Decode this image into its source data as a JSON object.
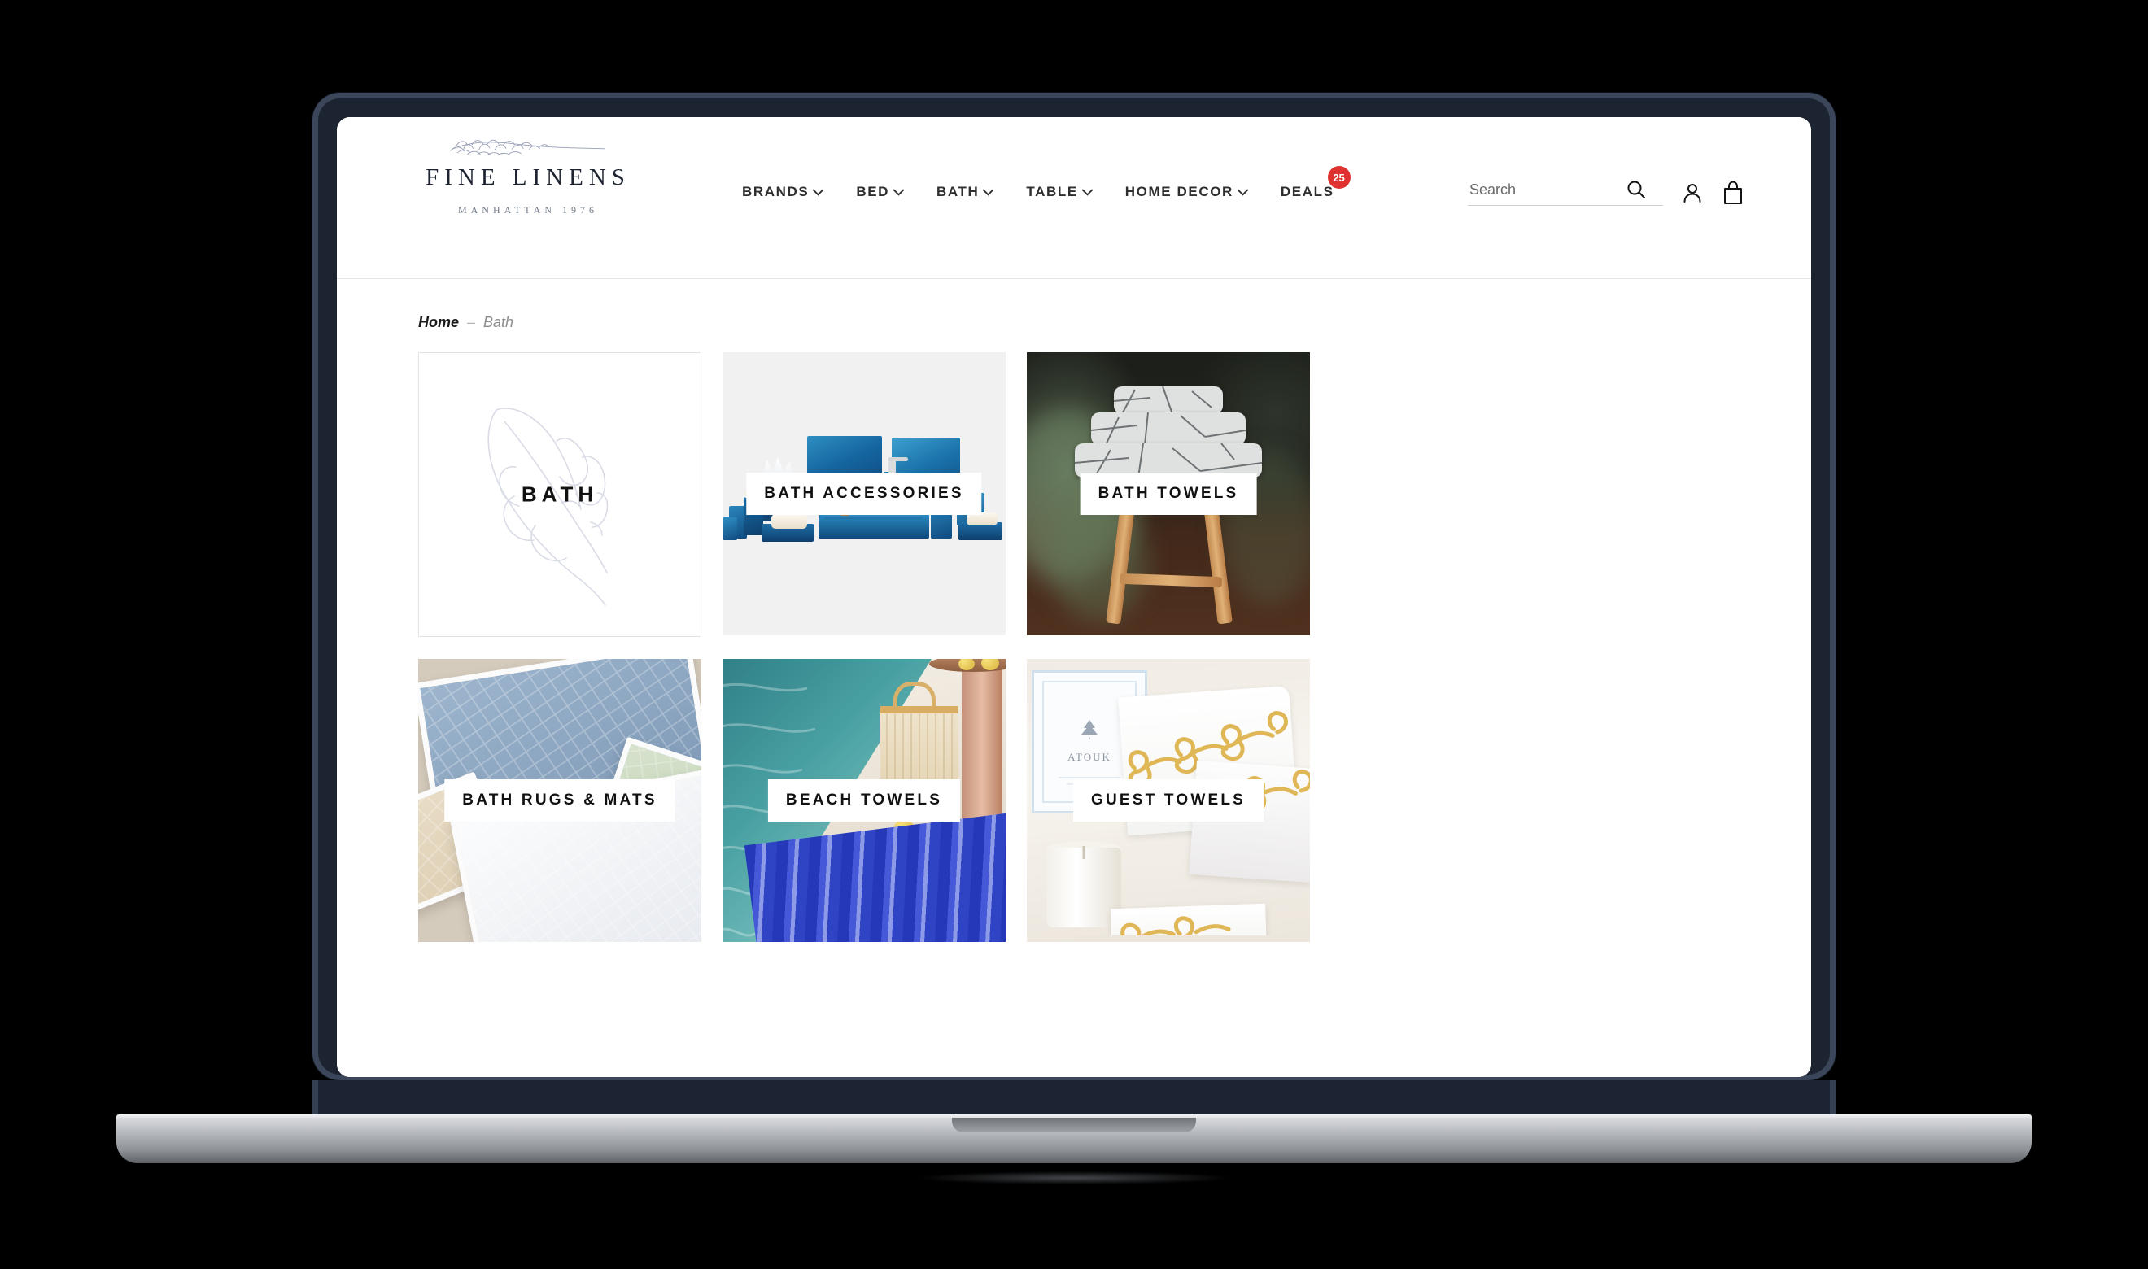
{
  "brand": {
    "name": "FINE LINENS",
    "tagline": "MANHATTAN 1976",
    "sprig_icon": "lavender-sprig-icon"
  },
  "nav": {
    "items": [
      {
        "label": "BRANDS",
        "has_dropdown": true
      },
      {
        "label": "BED",
        "has_dropdown": true
      },
      {
        "label": "BATH",
        "has_dropdown": true
      },
      {
        "label": "TABLE",
        "has_dropdown": true
      },
      {
        "label": "HOME DECOR",
        "has_dropdown": true
      },
      {
        "label": "DEALS",
        "has_dropdown": false,
        "badge": "25"
      }
    ]
  },
  "search": {
    "placeholder": "Search",
    "value": "",
    "icon": "search-icon"
  },
  "header_icons": {
    "account": "user-account-icon",
    "cart": "shopping-bag-icon"
  },
  "breadcrumb": {
    "home": "Home",
    "separator": "–",
    "current": "Bath"
  },
  "colors": {
    "badge_red": "#e03131",
    "nav_text": "#2e2e2e",
    "bezel": "#3b465a",
    "page_bg": "#000000"
  },
  "categories": [
    {
      "label": "BATH",
      "kind": "hero-illustration"
    },
    {
      "label": "BATH ACCESSORIES",
      "kind": "photo"
    },
    {
      "label": "BATH TOWELS",
      "kind": "photo"
    },
    {
      "label": "BATH RUGS & MATS",
      "kind": "photo"
    },
    {
      "label": "BEACH TOWELS",
      "kind": "photo"
    },
    {
      "label": "GUEST TOWELS",
      "kind": "photo"
    }
  ],
  "guest_box_label": "ATOUK"
}
